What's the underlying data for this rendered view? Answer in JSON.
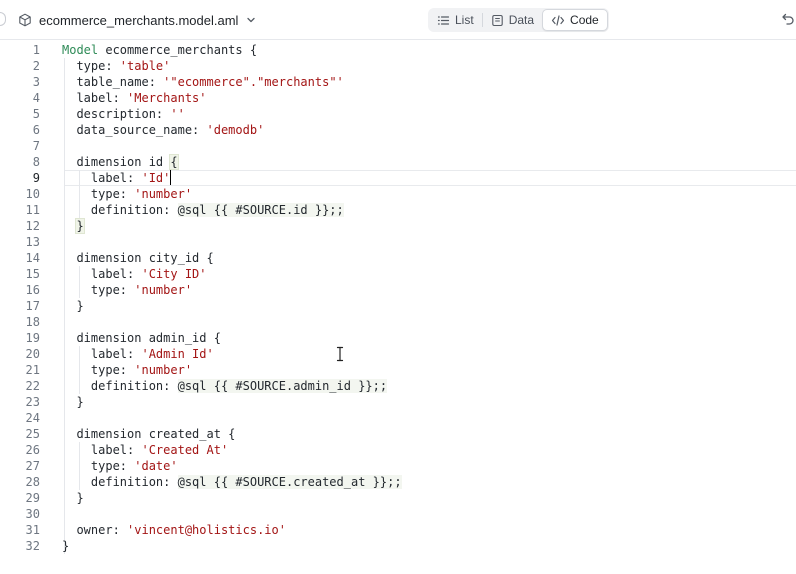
{
  "header": {
    "file_name": "ecommerce_merchants.model.aml",
    "file_icon": "cube-icon",
    "dropdown_icon": "chevron-down-icon",
    "views": [
      {
        "label": "List",
        "icon": "list-icon",
        "active": false
      },
      {
        "label": "Data",
        "icon": "table-icon",
        "active": false
      },
      {
        "label": "Code",
        "icon": "code-icon",
        "active": true
      }
    ],
    "undo_icon": "undo-icon"
  },
  "editor": {
    "current_line": 9,
    "cursor_after": "'Id'",
    "colors": {
      "keyword": "#2e8b57",
      "string": "#a31515",
      "plain": "#24292f",
      "line_number": "#6e7681",
      "bracket_match": "#f0f4e8"
    },
    "lines": [
      [
        {
          "t": "Model",
          "c": "keyword"
        },
        {
          "t": " ecommerce_merchants {"
        }
      ],
      [
        {
          "t": "  type: "
        },
        {
          "t": "'table'",
          "c": "string"
        }
      ],
      [
        {
          "t": "  table_name: "
        },
        {
          "t": "'\"ecommerce\".\"merchants\"'",
          "c": "string"
        }
      ],
      [
        {
          "t": "  label: "
        },
        {
          "t": "'Merchants'",
          "c": "string"
        }
      ],
      [
        {
          "t": "  description: "
        },
        {
          "t": "''",
          "c": "string"
        }
      ],
      [
        {
          "t": "  data_source_name: "
        },
        {
          "t": "'demodb'",
          "c": "string"
        }
      ],
      [
        {
          "t": ""
        }
      ],
      [
        {
          "t": "  dimension id "
        },
        {
          "t": "{",
          "c": "bracket"
        }
      ],
      [
        {
          "t": "    label: "
        },
        {
          "t": "'Id'",
          "c": "string"
        },
        {
          "t": "",
          "c": "caret"
        }
      ],
      [
        {
          "t": "    type: "
        },
        {
          "t": "'number'",
          "c": "string"
        }
      ],
      [
        {
          "t": "    definition: "
        },
        {
          "t": "@sql {{ #SOURCE.id }};;",
          "c": "sql"
        }
      ],
      [
        {
          "t": "  "
        },
        {
          "t": "}",
          "c": "bracket"
        }
      ],
      [
        {
          "t": ""
        }
      ],
      [
        {
          "t": "  dimension city_id {"
        }
      ],
      [
        {
          "t": "    label: "
        },
        {
          "t": "'City ID'",
          "c": "string"
        }
      ],
      [
        {
          "t": "    type: "
        },
        {
          "t": "'number'",
          "c": "string"
        }
      ],
      [
        {
          "t": "  }"
        }
      ],
      [
        {
          "t": ""
        }
      ],
      [
        {
          "t": "  dimension admin_id {"
        }
      ],
      [
        {
          "t": "    label: "
        },
        {
          "t": "'Admin Id'",
          "c": "string"
        }
      ],
      [
        {
          "t": "    type: "
        },
        {
          "t": "'number'",
          "c": "string"
        }
      ],
      [
        {
          "t": "    definition: "
        },
        {
          "t": "@sql {{ #SOURCE.admin_id }};;",
          "c": "sql"
        }
      ],
      [
        {
          "t": "  }"
        }
      ],
      [
        {
          "t": ""
        }
      ],
      [
        {
          "t": "  dimension created_at {"
        }
      ],
      [
        {
          "t": "    label: "
        },
        {
          "t": "'Created At'",
          "c": "string"
        }
      ],
      [
        {
          "t": "    type: "
        },
        {
          "t": "'date'",
          "c": "string"
        }
      ],
      [
        {
          "t": "    definition: "
        },
        {
          "t": "@sql {{ #SOURCE.created_at }};;",
          "c": "sql"
        }
      ],
      [
        {
          "t": "  }"
        }
      ],
      [
        {
          "t": ""
        }
      ],
      [
        {
          "t": "  owner: "
        },
        {
          "t": "'vincent@holistics.io'",
          "c": "string"
        }
      ],
      [
        {
          "t": "}"
        }
      ]
    ]
  }
}
